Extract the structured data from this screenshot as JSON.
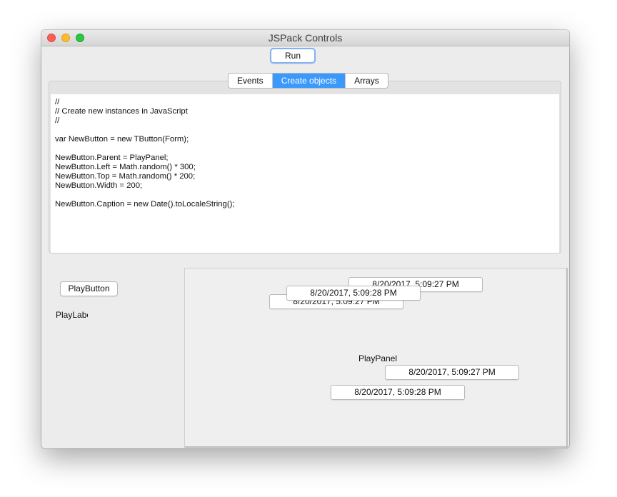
{
  "window": {
    "title": "JSPack Controls"
  },
  "toolbar": {
    "run_label": "Run"
  },
  "tabs": [
    {
      "label": "Events",
      "active": false
    },
    {
      "label": "Create objects",
      "active": true
    },
    {
      "label": "Arrays",
      "active": false
    }
  ],
  "code_lines": [
    "//",
    "// Create new instances in JavaScript",
    "//",
    "",
    "var NewButton = new TButton(Form);",
    "",
    "NewButton.Parent = PlayPanel;",
    "NewButton.Left = Math.random() * 300;",
    "NewButton.Top = Math.random() * 200;",
    "NewButton.Width = 200;",
    "",
    "NewButton.Caption = new Date().toLocaleString();"
  ],
  "play": {
    "button_label": "PlayButton",
    "label_text": "PlayLabel",
    "panel_caption": "PlayPanel"
  },
  "created_buttons": [
    {
      "caption": "8/20/2017, 5:09:27 PM"
    },
    {
      "caption": "8/20/2017, 5:09:27 PM"
    },
    {
      "caption": "8/20/2017, 5:09:28 PM"
    },
    {
      "caption": "8/20/2017, 5:09:27 PM"
    },
    {
      "caption": "8/20/2017, 5:09:28 PM"
    }
  ],
  "colors": {
    "accent": "#3b99fc",
    "traffic_close": "#fc5f57",
    "traffic_minimize": "#fdbc2e",
    "traffic_zoom": "#28c840"
  }
}
